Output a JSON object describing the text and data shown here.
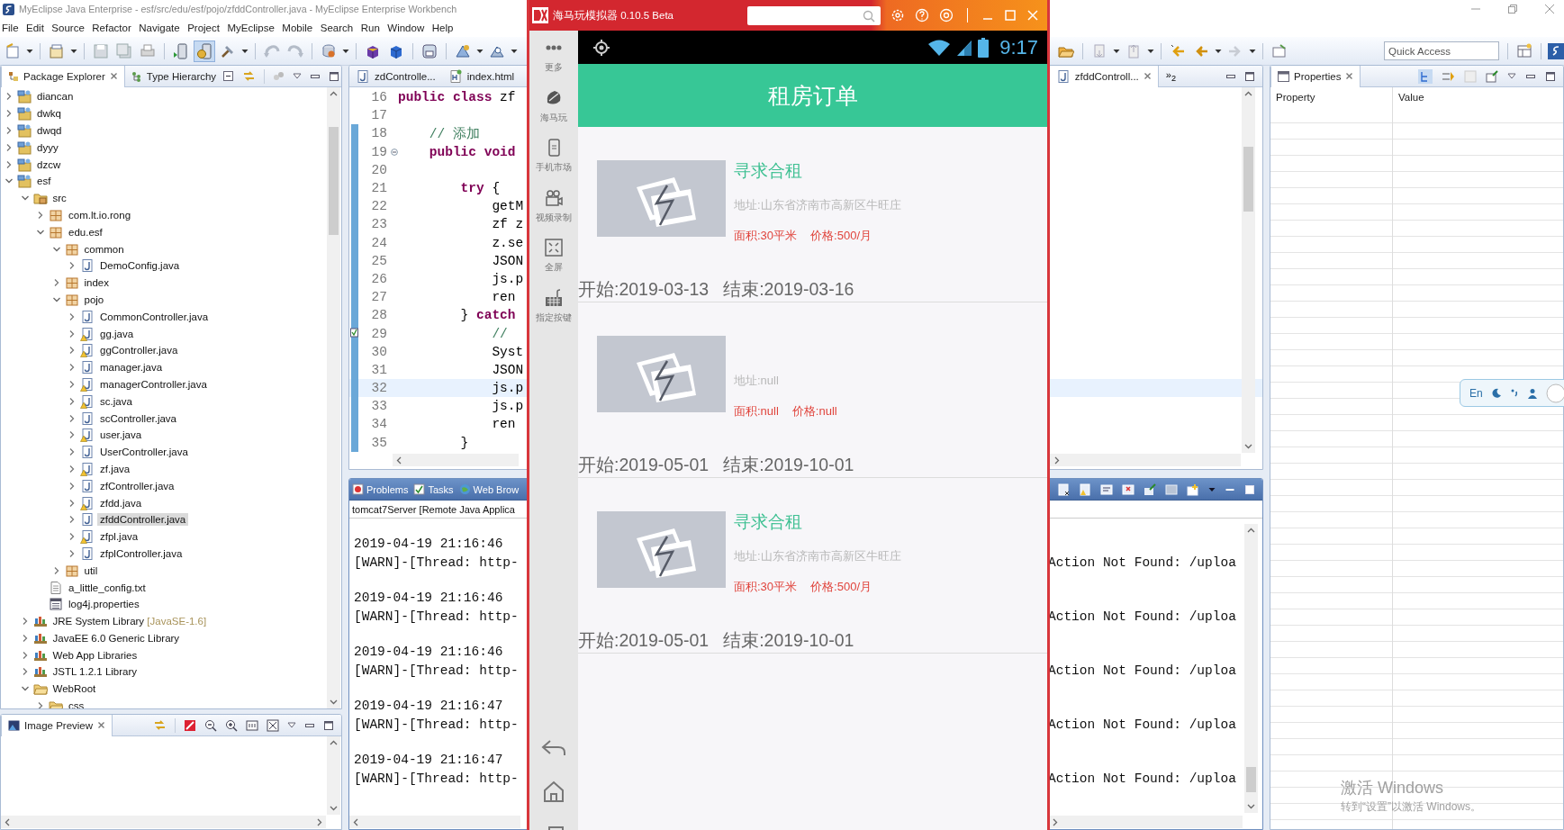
{
  "ide": {
    "title": "MyEclipse Java Enterprise - esf/src/edu/esf/pojo/zfddController.java - MyEclipse Enterprise Workbench",
    "menu": [
      "File",
      "Edit",
      "Source",
      "Refactor",
      "Navigate",
      "Project",
      "MyEclipse",
      "Mobile",
      "Search",
      "Run",
      "Window",
      "Help"
    ],
    "quick_access": {
      "placeholder": "Quick Access"
    }
  },
  "package_explorer": {
    "tabs": [
      {
        "label": "Package Explorer",
        "selected": true
      },
      {
        "label": "Type Hierarchy",
        "selected": false
      }
    ],
    "tree": [
      {
        "label": "diancan",
        "kind": "project",
        "expanded": false,
        "selected": false
      },
      {
        "label": "dwkq",
        "kind": "project",
        "expanded": false,
        "selected": false
      },
      {
        "label": "dwqd",
        "kind": "project",
        "expanded": false,
        "selected": false
      },
      {
        "label": "dyyy",
        "kind": "project",
        "expanded": false,
        "selected": false
      },
      {
        "label": "dzcw",
        "kind": "project",
        "expanded": false,
        "selected": false
      },
      {
        "label": "esf",
        "kind": "project",
        "expanded": true,
        "selected": false,
        "children": [
          {
            "label": "src",
            "kind": "source-folder",
            "expanded": true,
            "selected": false,
            "children": [
              {
                "label": "com.lt.io.rong",
                "kind": "package",
                "expanded": false,
                "selected": false
              },
              {
                "label": "edu.esf",
                "kind": "package",
                "expanded": true,
                "selected": false,
                "children": [
                  {
                    "label": "common",
                    "kind": "package",
                    "expanded": true,
                    "selected": false,
                    "children": [
                      {
                        "label": "DemoConfig.java",
                        "kind": "java",
                        "expanded": false,
                        "selected": false,
                        "warning": false
                      }
                    ]
                  },
                  {
                    "label": "index",
                    "kind": "package",
                    "expanded": false,
                    "selected": false
                  },
                  {
                    "label": "pojo",
                    "kind": "package",
                    "expanded": true,
                    "selected": false,
                    "children": [
                      {
                        "label": "CommonController.java",
                        "kind": "java",
                        "expanded": false,
                        "selected": false,
                        "warning": false
                      },
                      {
                        "label": "gg.java",
                        "kind": "java",
                        "expanded": false,
                        "selected": false,
                        "warning": true
                      },
                      {
                        "label": "ggController.java",
                        "kind": "java",
                        "expanded": false,
                        "selected": false,
                        "warning": true
                      },
                      {
                        "label": "manager.java",
                        "kind": "java",
                        "expanded": false,
                        "selected": false,
                        "warning": false
                      },
                      {
                        "label": "managerController.java",
                        "kind": "java",
                        "expanded": false,
                        "selected": false,
                        "warning": true
                      },
                      {
                        "label": "sc.java",
                        "kind": "java",
                        "expanded": false,
                        "selected": false,
                        "warning": true
                      },
                      {
                        "label": "scController.java",
                        "kind": "java",
                        "expanded": false,
                        "selected": false,
                        "warning": false
                      },
                      {
                        "label": "user.java",
                        "kind": "java",
                        "expanded": false,
                        "selected": false,
                        "warning": true
                      },
                      {
                        "label": "UserController.java",
                        "kind": "java",
                        "expanded": false,
                        "selected": false,
                        "warning": false
                      },
                      {
                        "label": "zf.java",
                        "kind": "java",
                        "expanded": false,
                        "selected": false,
                        "warning": true
                      },
                      {
                        "label": "zfController.java",
                        "kind": "java",
                        "expanded": false,
                        "selected": false,
                        "warning": false
                      },
                      {
                        "label": "zfdd.java",
                        "kind": "java",
                        "expanded": false,
                        "selected": false,
                        "warning": true
                      },
                      {
                        "label": "zfddController.java",
                        "kind": "java",
                        "expanded": false,
                        "selected": true,
                        "warning": false
                      },
                      {
                        "label": "zfpl.java",
                        "kind": "java",
                        "expanded": false,
                        "selected": false,
                        "warning": true
                      },
                      {
                        "label": "zfplController.java",
                        "kind": "java",
                        "expanded": false,
                        "selected": false,
                        "warning": false
                      }
                    ]
                  },
                  {
                    "label": "util",
                    "kind": "package",
                    "expanded": false,
                    "selected": false
                  }
                ]
              },
              {
                "label": "a_little_config.txt",
                "kind": "text",
                "selected": false
              },
              {
                "label": "log4j.properties",
                "kind": "properties",
                "selected": false
              }
            ]
          },
          {
            "label": "JRE System Library",
            "decoration": "[JavaSE-1.6]",
            "kind": "library",
            "expanded": false,
            "selected": false
          },
          {
            "label": "JavaEE 6.0 Generic Library",
            "kind": "library",
            "expanded": false,
            "selected": false
          },
          {
            "label": "Web App Libraries",
            "kind": "library",
            "expanded": false,
            "selected": false
          },
          {
            "label": "JSTL 1.2.1 Library",
            "kind": "library",
            "expanded": false,
            "selected": false
          },
          {
            "label": "WebRoot",
            "kind": "folder",
            "expanded": true,
            "selected": false,
            "children": [
              {
                "label": "css",
                "kind": "folder",
                "expanded": false,
                "selected": false
              }
            ]
          }
        ]
      }
    ]
  },
  "image_preview": {
    "tab": "Image Preview"
  },
  "editor": {
    "tabs": [
      {
        "label": "zdControlle...",
        "kind": "java",
        "selected": false
      },
      {
        "label": "index.html",
        "kind": "html",
        "selected": false
      },
      {
        "label": "zfddControll...",
        "kind": "java",
        "selected": true
      }
    ],
    "overflow": "»$_{2}$",
    "lines": [
      {
        "number": "16",
        "kind": "plain",
        "scope": false,
        "highlighted": false,
        "tokens": [
          {
            "text": "public class",
            "kind": "keyword"
          },
          {
            "text": " zf",
            "kind": "plain"
          }
        ]
      },
      {
        "number": "17",
        "kind": "plain",
        "scope": false,
        "highlighted": false
      },
      {
        "number": "18",
        "kind": "plain",
        "scope": true,
        "highlighted": false,
        "tokens": [
          {
            "text": "    // 添加",
            "kind": "comment"
          }
        ]
      },
      {
        "number": "19",
        "kind": "fold",
        "scope": true,
        "highlighted": false,
        "tokens": [
          {
            "text": "    public void",
            "kind": "keyword"
          }
        ]
      },
      {
        "number": "20",
        "kind": "plain",
        "scope": true,
        "highlighted": false
      },
      {
        "number": "21",
        "kind": "plain",
        "scope": true,
        "highlighted": false,
        "tokens": [
          {
            "text": "        try",
            "kind": "keyword"
          },
          {
            "text": " {",
            "kind": "plain"
          }
        ]
      },
      {
        "number": "22",
        "kind": "plain",
        "scope": true,
        "highlighted": false,
        "tokens": [
          {
            "text": "            getM",
            "kind": "plain"
          }
        ]
      },
      {
        "number": "23",
        "kind": "plain",
        "scope": true,
        "highlighted": false,
        "tokens": [
          {
            "text": "            zf z",
            "kind": "plain"
          }
        ]
      },
      {
        "number": "24",
        "kind": "plain",
        "scope": true,
        "highlighted": false,
        "tokens": [
          {
            "text": "            z.se",
            "kind": "plain"
          }
        ]
      },
      {
        "number": "25",
        "kind": "plain",
        "scope": true,
        "highlighted": false,
        "tokens": [
          {
            "text": "            JSON",
            "kind": "plain"
          }
        ]
      },
      {
        "number": "26",
        "kind": "plain",
        "scope": true,
        "highlighted": false,
        "tokens": [
          {
            "text": "            js.p",
            "kind": "plain"
          }
        ]
      },
      {
        "number": "27",
        "kind": "plain",
        "scope": true,
        "highlighted": false,
        "tokens": [
          {
            "text": "            ren",
            "kind": "plain"
          }
        ]
      },
      {
        "number": "28",
        "kind": "plain",
        "scope": true,
        "highlighted": false,
        "tokens": [
          {
            "text": "        } ",
            "kind": "plain"
          },
          {
            "text": "catch",
            "kind": "keyword"
          }
        ]
      },
      {
        "number": "29",
        "kind": "task",
        "scope": true,
        "highlighted": false,
        "tokens": [
          {
            "text": "            //",
            "kind": "comment"
          }
        ]
      },
      {
        "number": "30",
        "kind": "plain",
        "scope": true,
        "highlighted": false,
        "tokens": [
          {
            "text": "            Syst",
            "kind": "plain"
          }
        ]
      },
      {
        "number": "31",
        "kind": "plain",
        "scope": true,
        "highlighted": false,
        "tokens": [
          {
            "text": "            JSON",
            "kind": "plain"
          }
        ]
      },
      {
        "number": "32",
        "kind": "plain",
        "scope": true,
        "highlighted": true,
        "tokens": [
          {
            "text": "            js.p",
            "kind": "plain"
          }
        ]
      },
      {
        "number": "33",
        "kind": "plain",
        "scope": true,
        "highlighted": false,
        "tokens": [
          {
            "text": "            js.p",
            "kind": "plain"
          }
        ]
      },
      {
        "number": "34",
        "kind": "plain",
        "scope": true,
        "highlighted": false,
        "tokens": [
          {
            "text": "            ren",
            "kind": "plain"
          }
        ]
      },
      {
        "number": "35",
        "kind": "plain",
        "scope": true,
        "highlighted": false,
        "tokens": [
          {
            "text": "        }",
            "kind": "plain"
          }
        ]
      }
    ]
  },
  "console": {
    "tabs": [
      {
        "label": "Problems",
        "selected": false
      },
      {
        "label": "Tasks",
        "selected": false
      },
      {
        "label": "Web Brow",
        "selected": false
      }
    ],
    "process": "tomcat7Server [Remote Java Applica",
    "entries": [
      {
        "time": "2019-04-19 21:16:46",
        "message": "[WARN]-[Thread: http-",
        "detail": "Action Not Found: /uploa"
      },
      {
        "time": "2019-04-19 21:16:46",
        "message": "[WARN]-[Thread: http-",
        "detail": "Action Not Found: /uploa"
      },
      {
        "time": "2019-04-19 21:16:46",
        "message": "[WARN]-[Thread: http-",
        "detail": "Action Not Found: /uploa"
      },
      {
        "time": "2019-04-19 21:16:47",
        "message": "[WARN]-[Thread: http-",
        "detail": "Action Not Found: /uploa"
      },
      {
        "time": "2019-04-19 21:16:47",
        "message": "[WARN]-[Thread: http-",
        "detail": "Action Not Found: /uploa"
      }
    ]
  },
  "properties": {
    "tab": "Properties",
    "columns": [
      "Property",
      "Value"
    ]
  },
  "os_notice": {
    "title": "激活 Windows",
    "subtitle": "转到“设置”以激活 Windows。"
  },
  "ime": {
    "mode": "En"
  },
  "emulator": {
    "title": "海马玩模拟器 0.10.5 Beta",
    "sidebar": [
      "更多",
      "海马玩",
      "手机市场",
      "视频录制",
      "全屏",
      "指定按键"
    ],
    "time": "9:17",
    "app": {
      "title": "租房订单",
      "orders": [
        {
          "title": "寻求合租",
          "address": "地址:山东省济南市高新区牛旺庄",
          "area": "面积:30平米",
          "price": "价格:500/月",
          "start": "开始:2019-03-13",
          "end": "结束:2019-03-16"
        },
        {
          "address": "地址:null",
          "area": "面积:null",
          "price": "价格:null",
          "start": "开始:2019-05-01",
          "end": "结束:2019-10-01"
        },
        {
          "title": "寻求合租",
          "address": "地址:山东省济南市高新区牛旺庄",
          "area": "面积:30平米",
          "price": "价格:500/月",
          "start": "开始:2019-05-01",
          "end": "结束:2019-10-01"
        }
      ]
    }
  }
}
